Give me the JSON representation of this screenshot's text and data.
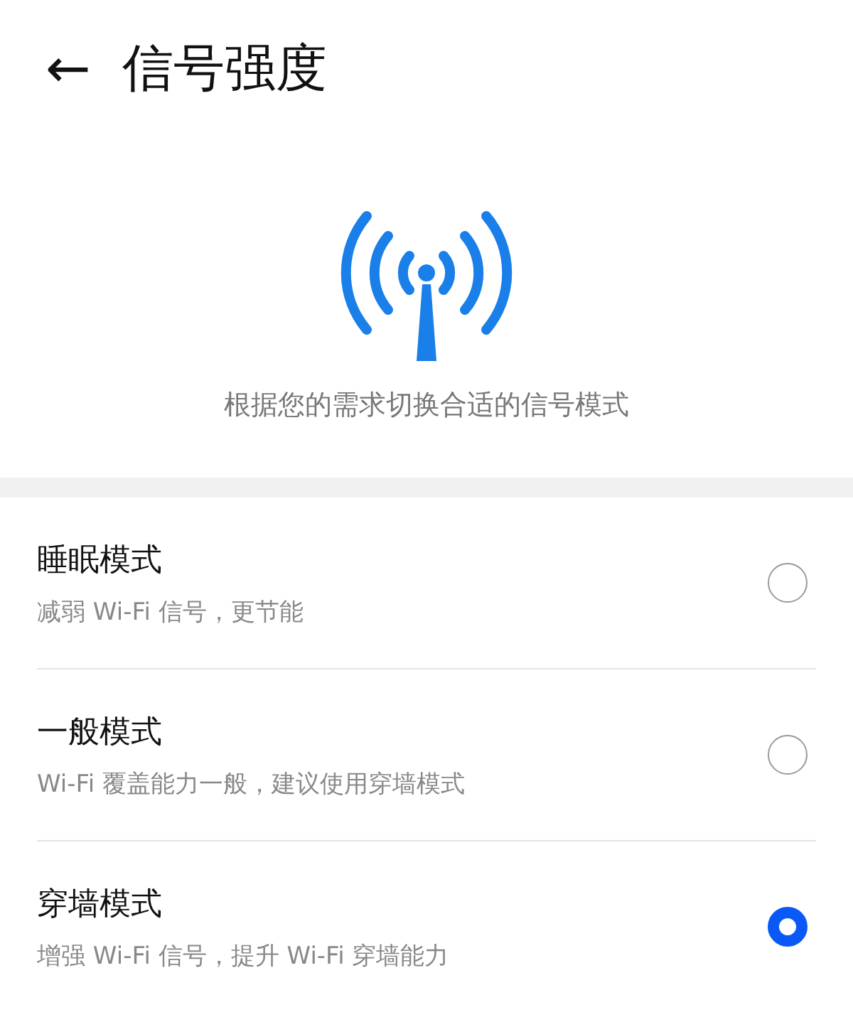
{
  "header": {
    "back": "←",
    "title": "信号强度"
  },
  "description": "根据您的需求切换合适的信号模式",
  "modes": [
    {
      "title": "睡眠模式",
      "subtitle": "减弱 Wi-Fi 信号，更节能",
      "selected": false
    },
    {
      "title": "一般模式",
      "subtitle": "Wi-Fi 覆盖能力一般，建议使用穿墙模式",
      "selected": false
    },
    {
      "title": "穿墙模式",
      "subtitle": "增强 Wi-Fi 信号，提升 Wi-Fi 穿墙能力",
      "selected": true
    }
  ]
}
